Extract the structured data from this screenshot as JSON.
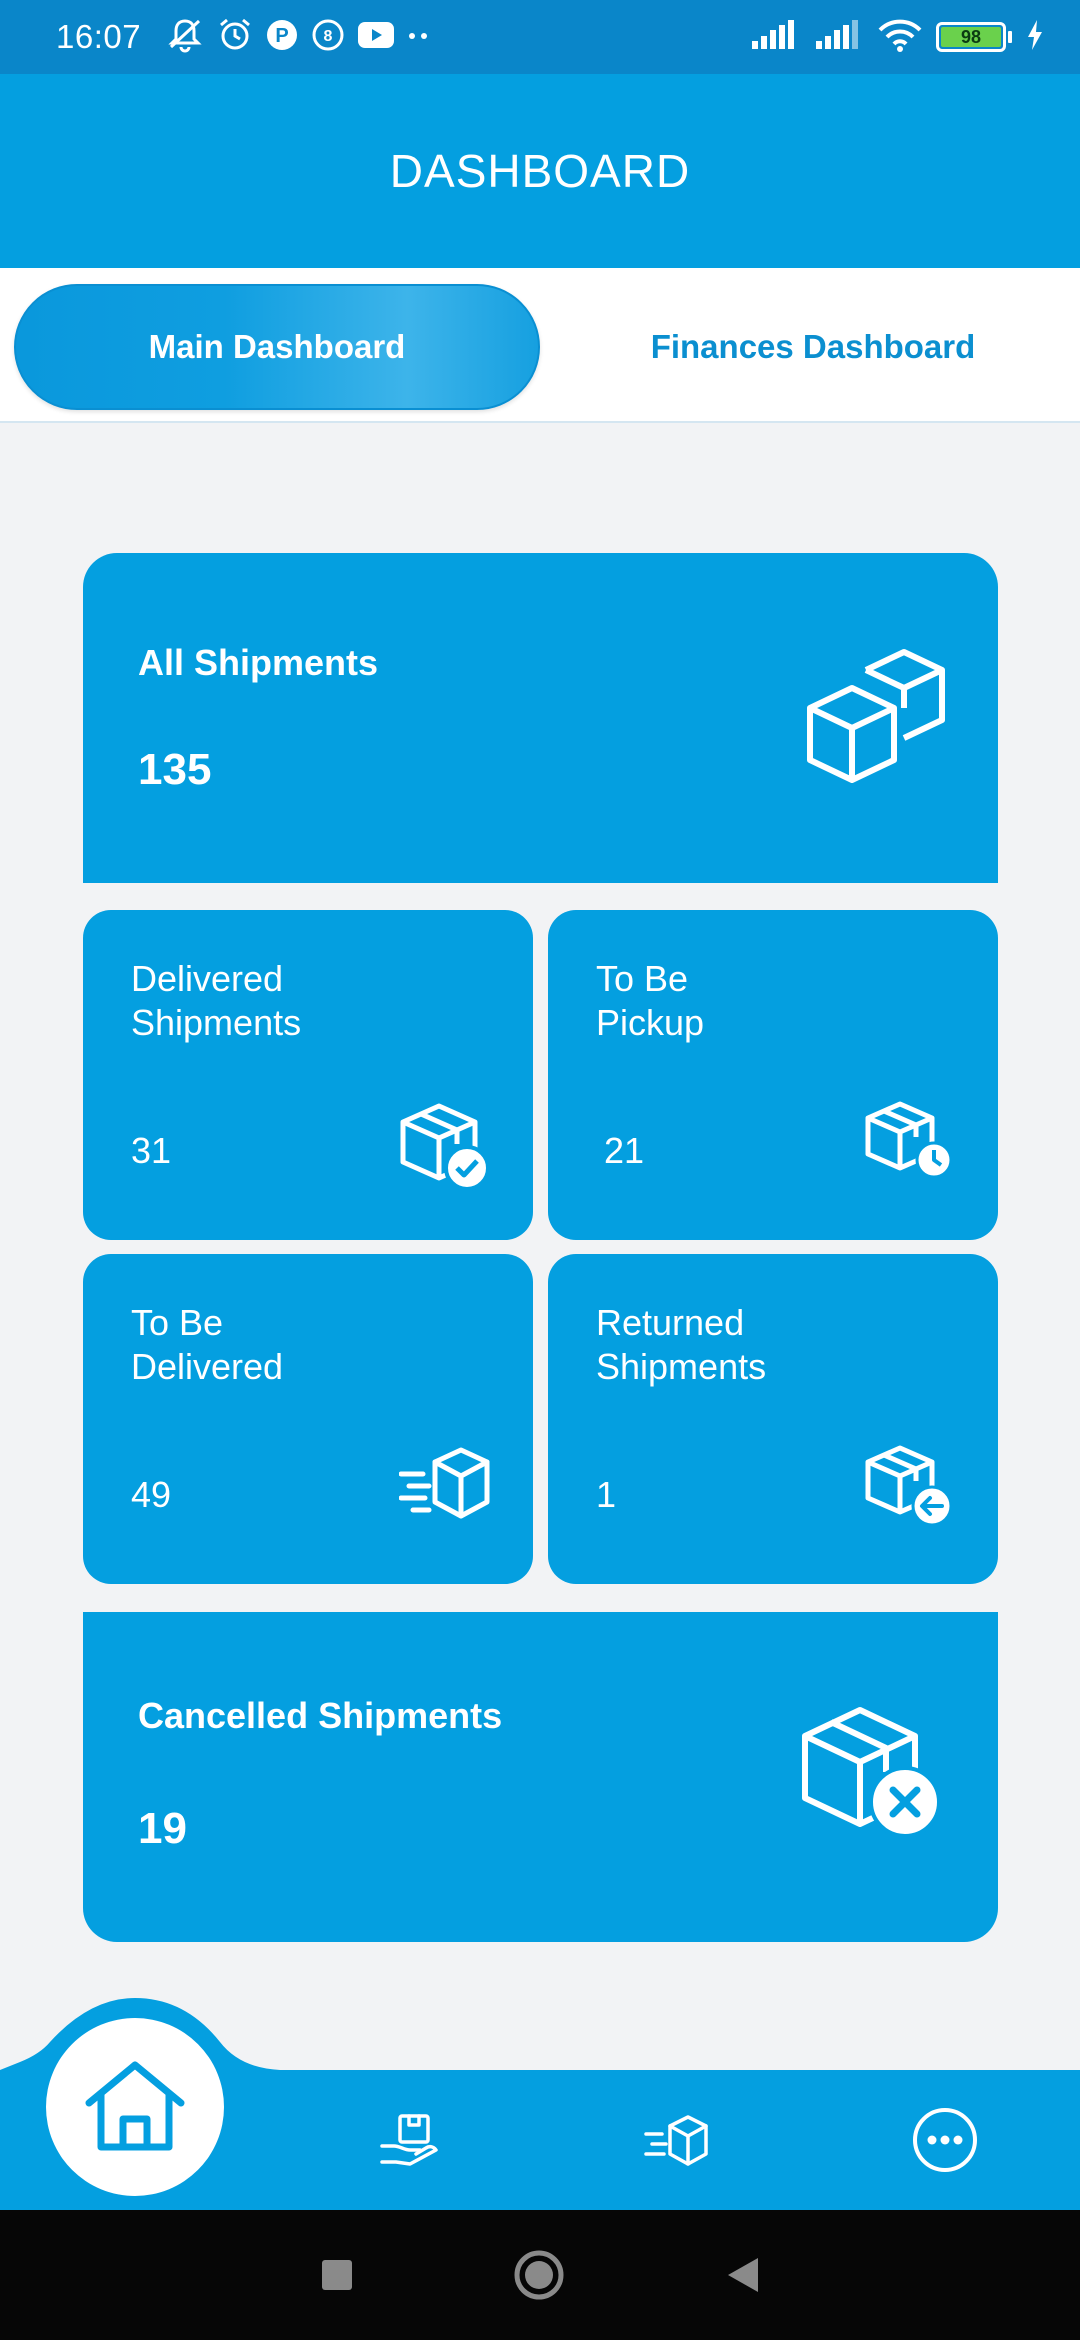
{
  "status_bar": {
    "time": "16:07",
    "battery": "98"
  },
  "header": {
    "title": "DASHBOARD"
  },
  "tabs": [
    {
      "label": "Main Dashboard",
      "active": true
    },
    {
      "label": "Finances Dashboard",
      "active": false
    }
  ],
  "cards": {
    "all": {
      "label": "All Shipments",
      "count": "135",
      "icon": "boxes-icon"
    },
    "delivered": {
      "label": "Delivered Shipments",
      "count": "31",
      "icon": "box-check-icon"
    },
    "pickup": {
      "label": "To Be Pickup",
      "count": "21",
      "icon": "box-clock-icon"
    },
    "to_be_delivered": {
      "label": "To Be Delivered",
      "count": "49",
      "icon": "box-fast-icon"
    },
    "returned": {
      "label": "Returned Shipments",
      "count": "1",
      "icon": "box-return-icon"
    },
    "cancelled": {
      "label": "Cancelled Shipments",
      "count": "19",
      "icon": "box-cancel-icon"
    }
  },
  "bottom_nav": {
    "items": [
      "home-icon",
      "receive-package-icon",
      "shipping-box-icon",
      "more-icon"
    ]
  },
  "colors": {
    "primary": "#049fe0",
    "status_bar": "#0a86c9",
    "tab_text": "#0b8fd0",
    "background": "#f2f3f5",
    "battery": "#6ad14c"
  }
}
